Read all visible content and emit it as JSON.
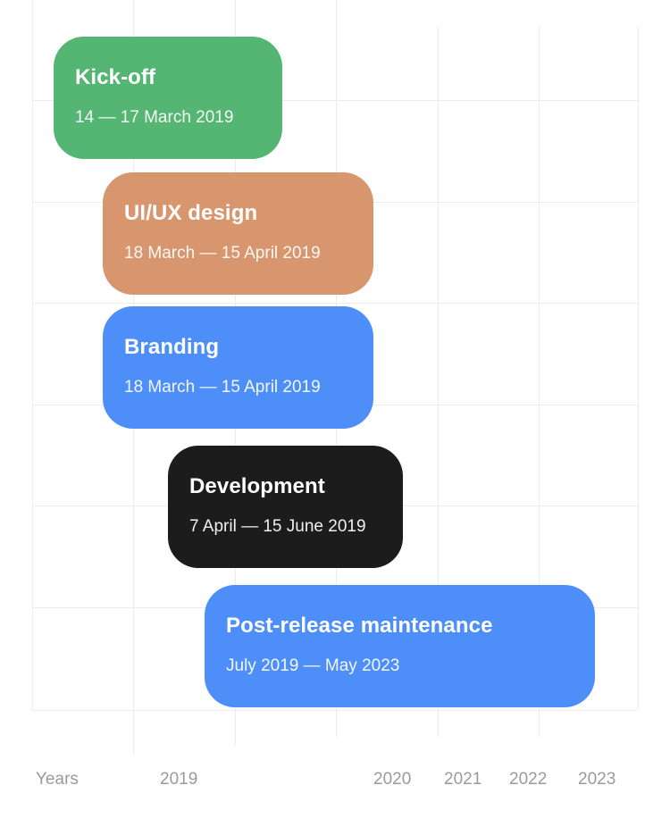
{
  "chart_data": {
    "type": "gantt",
    "tasks": [
      {
        "name": "Kick-off",
        "dates": "14 — 17 March 2019",
        "color": "#55b572"
      },
      {
        "name": "UI/UX design",
        "dates": "18 March — 15 April 2019",
        "color": "#d7966e"
      },
      {
        "name": "Branding",
        "dates": "18 March — 15 April 2019",
        "color": "#4d8ef8"
      },
      {
        "name": "Development",
        "dates": "7 April — 15 June 2019",
        "color": "#1c1c1c"
      },
      {
        "name": "Post-release maintenance",
        "dates": "July 2019 — May 2023",
        "color": "#4d8ef8"
      }
    ],
    "axis": {
      "label": "Years",
      "ticks": [
        "2019",
        "2020",
        "2021",
        "2022",
        "2023"
      ]
    },
    "grid": true
  }
}
